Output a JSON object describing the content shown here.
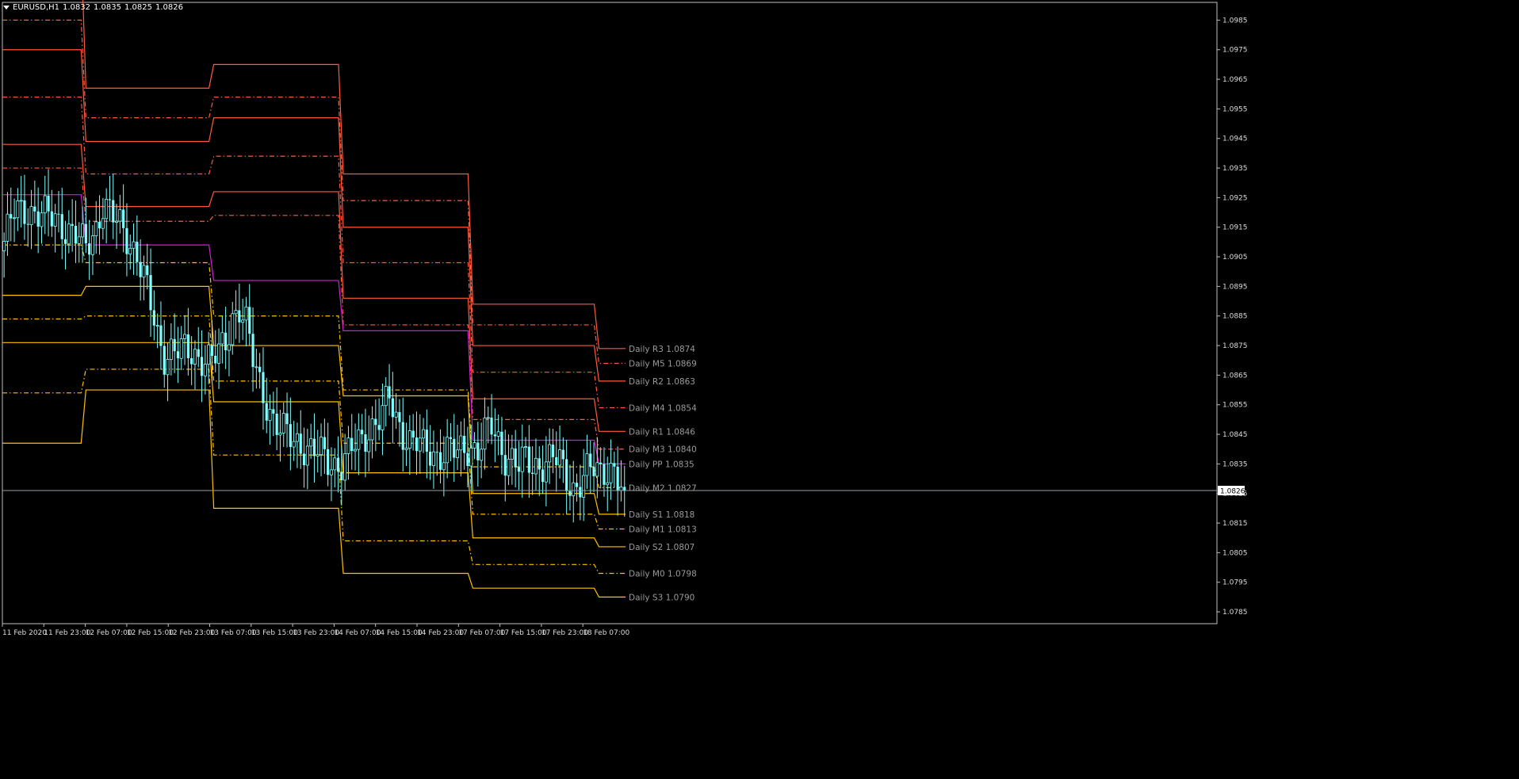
{
  "header": {
    "symbol": "EURUSD,H1",
    "open": "1.0832",
    "high": "1.0835",
    "low": "1.0825",
    "close": "1.0826"
  },
  "colors": {
    "background": "#000000",
    "axis": "#bfbfbf",
    "candle": "#7fffff",
    "resistance": "#ff5a3c",
    "pivot": "#d21ed2",
    "support": "#ffc000",
    "bid_line": "#9aa0a6",
    "level_label": "#9a9a9a"
  },
  "chart_data": {
    "type": "candlestick",
    "symbol": "EURUSD",
    "timeframe": "H1",
    "ylim": [
      1.0781,
      1.0991
    ],
    "y_ticks": [
      "1.0985",
      "1.0975",
      "1.0965",
      "1.0955",
      "1.0945",
      "1.0935",
      "1.0925",
      "1.0915",
      "1.0905",
      "1.0895",
      "1.0885",
      "1.0875",
      "1.0865",
      "1.0855",
      "1.0845",
      "1.0835",
      "1.0825",
      "1.0815",
      "1.0805",
      "1.0795",
      "1.0785"
    ],
    "current_price": "1.0826",
    "x_ticks": [
      "11 Feb 2020",
      "11 Feb 23:00",
      "12 Feb 07:00",
      "12 Feb 15:00",
      "12 Feb 23:00",
      "13 Feb 07:00",
      "13 Feb 15:00",
      "13 Feb 23:00",
      "14 Feb 07:00",
      "14 Feb 15:00",
      "14 Feb 23:00",
      "17 Feb 07:00",
      "17 Feb 15:00",
      "17 Feb 23:00",
      "18 Feb 07:00"
    ],
    "day_boundaries": [
      0,
      24.5,
      62,
      100,
      138,
      175
    ],
    "pivot_levels": [
      {
        "key": "R3",
        "kind": "r",
        "style": "solid",
        "values": [
          1.101,
          1.0962,
          1.097,
          1.0933,
          1.0889,
          1.0874
        ]
      },
      {
        "key": "M5",
        "kind": "r",
        "style": "dash",
        "values": [
          1.0985,
          1.0952,
          1.0959,
          1.0924,
          1.0882,
          1.0869
        ]
      },
      {
        "key": "R2",
        "kind": "r",
        "style": "solid",
        "values": [
          1.0975,
          1.0944,
          1.0952,
          1.0915,
          1.0875,
          1.0863
        ]
      },
      {
        "key": "M4",
        "kind": "r",
        "style": "dash",
        "values": [
          1.0959,
          1.0933,
          1.0939,
          1.0903,
          1.0866,
          1.0854
        ]
      },
      {
        "key": "R1",
        "kind": "r",
        "style": "solid",
        "values": [
          1.0943,
          1.0922,
          1.0927,
          1.0891,
          1.0857,
          1.0846
        ]
      },
      {
        "key": "M3",
        "kind": "r",
        "style": "dash",
        "values": [
          1.0935,
          1.0917,
          1.0919,
          1.0882,
          1.085,
          1.084
        ]
      },
      {
        "key": "PP",
        "kind": "p",
        "style": "solid",
        "values": [
          1.0926,
          1.0909,
          1.0897,
          1.088,
          1.0843,
          1.0835
        ]
      },
      {
        "key": "M2",
        "kind": "s",
        "style": "dash",
        "values": [
          1.0909,
          1.0903,
          1.0885,
          1.086,
          1.0834,
          1.0827
        ]
      },
      {
        "key": "S1",
        "kind": "s",
        "style": "solid",
        "values": [
          1.0892,
          1.0895,
          1.0875,
          1.0858,
          1.0825,
          1.0818
        ]
      },
      {
        "key": "M1",
        "kind": "s",
        "style": "dash",
        "values": [
          1.0884,
          1.0885,
          1.0863,
          1.0842,
          1.0818,
          1.0813
        ]
      },
      {
        "key": "S2",
        "kind": "s",
        "style": "solid",
        "values": [
          1.0876,
          1.0876,
          1.0856,
          1.0832,
          1.081,
          1.0807
        ]
      },
      {
        "key": "M0",
        "kind": "s",
        "style": "dash",
        "values": [
          1.0859,
          1.0867,
          1.0838,
          1.0809,
          1.0801,
          1.0798
        ]
      },
      {
        "key": "S3",
        "kind": "s",
        "style": "solid",
        "values": [
          1.0842,
          1.086,
          1.082,
          1.0798,
          1.0793,
          1.079
        ]
      }
    ],
    "level_labels": [
      {
        "key": "R3",
        "text": "Daily R3 1.0874"
      },
      {
        "key": "M5",
        "text": "Daily M5 1.0869"
      },
      {
        "key": "R2",
        "text": "Daily R2 1.0863"
      },
      {
        "key": "M4",
        "text": "Daily M4 1.0854"
      },
      {
        "key": "R1",
        "text": "Daily R1 1.0846"
      },
      {
        "key": "M3",
        "text": "Daily M3 1.0840"
      },
      {
        "key": "PP",
        "text": "Daily PP 1.0835"
      },
      {
        "key": "M2",
        "text": "Daily M2 1.0827"
      },
      {
        "key": "S1",
        "text": "Daily S1 1.0818"
      },
      {
        "key": "M1",
        "text": "Daily M1 1.0813"
      },
      {
        "key": "S2",
        "text": "Daily S2 1.0807"
      },
      {
        "key": "M0",
        "text": "Daily M0 1.0798"
      },
      {
        "key": "S3",
        "text": "Daily S3 1.0790"
      }
    ],
    "price_path": [
      [
        0,
        1.0907
      ],
      [
        4,
        1.092
      ],
      [
        8,
        1.0921
      ],
      [
        12,
        1.0919
      ],
      [
        16,
        1.0918
      ],
      [
        20,
        1.0914
      ],
      [
        22,
        1.0912
      ],
      [
        25,
        1.0908
      ],
      [
        28,
        1.0915
      ],
      [
        30,
        1.0923
      ],
      [
        33,
        1.0918
      ],
      [
        36,
        1.0914
      ],
      [
        38,
        1.091
      ],
      [
        40,
        1.0906
      ],
      [
        42,
        1.0898
      ],
      [
        44,
        1.0888
      ],
      [
        46,
        1.0878
      ],
      [
        48,
        1.0872
      ],
      [
        50,
        1.0874
      ],
      [
        53,
        1.0873
      ],
      [
        56,
        1.0872
      ],
      [
        60,
        1.0871
      ],
      [
        62,
        1.087
      ],
      [
        64,
        1.0872
      ],
      [
        66,
        1.0876
      ],
      [
        68,
        1.0885
      ],
      [
        70,
        1.0888
      ],
      [
        72,
        1.0882
      ],
      [
        74,
        1.087
      ],
      [
        76,
        1.0862
      ],
      [
        78,
        1.0856
      ],
      [
        80,
        1.085
      ],
      [
        82,
        1.0846
      ],
      [
        84,
        1.0845
      ],
      [
        86,
        1.0843
      ],
      [
        88,
        1.0842
      ],
      [
        90,
        1.084
      ],
      [
        92,
        1.0839
      ],
      [
        94,
        1.0838
      ],
      [
        96,
        1.0836
      ],
      [
        98,
        1.0835
      ],
      [
        100,
        1.0835
      ],
      [
        102,
        1.0838
      ],
      [
        104,
        1.0841
      ],
      [
        106,
        1.0843
      ],
      [
        108,
        1.0847
      ],
      [
        110,
        1.0849
      ],
      [
        112,
        1.0852
      ],
      [
        114,
        1.0857
      ],
      [
        116,
        1.085
      ],
      [
        118,
        1.0846
      ],
      [
        120,
        1.0843
      ],
      [
        122,
        1.0842
      ],
      [
        124,
        1.084
      ],
      [
        126,
        1.0839
      ],
      [
        128,
        1.0838
      ],
      [
        130,
        1.0839
      ],
      [
        132,
        1.084
      ],
      [
        134,
        1.0838
      ],
      [
        136,
        1.084
      ],
      [
        138,
        1.0841
      ],
      [
        140,
        1.084
      ],
      [
        142,
        1.0845
      ],
      [
        144,
        1.0847
      ],
      [
        146,
        1.0842
      ],
      [
        148,
        1.0838
      ],
      [
        150,
        1.0837
      ],
      [
        152,
        1.0834
      ],
      [
        154,
        1.0836
      ],
      [
        156,
        1.0834
      ],
      [
        158,
        1.0835
      ],
      [
        160,
        1.0836
      ],
      [
        162,
        1.0837
      ],
      [
        164,
        1.0835
      ],
      [
        166,
        1.083
      ],
      [
        168,
        1.0827
      ],
      [
        170,
        1.0829
      ],
      [
        172,
        1.0832
      ],
      [
        174,
        1.0833
      ],
      [
        176,
        1.0832
      ],
      [
        178,
        1.0834
      ],
      [
        180,
        1.0833
      ],
      [
        182,
        1.0826
      ]
    ]
  }
}
